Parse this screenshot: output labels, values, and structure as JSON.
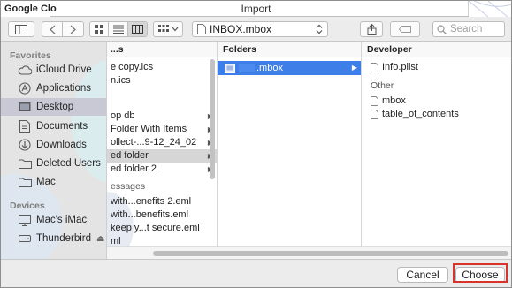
{
  "window": {
    "background_title": "Google Clo",
    "dialog_title": "Import"
  },
  "toolbar": {
    "path_label": "INBOX.mbox",
    "search_placeholder": "Search"
  },
  "sidebar": {
    "favorites_heading": "Favorites",
    "favorites": [
      {
        "label": "iCloud Drive",
        "icon": "cloud-icon"
      },
      {
        "label": "Applications",
        "icon": "applications-icon"
      },
      {
        "label": "Desktop",
        "icon": "desktop-icon",
        "selected": true
      },
      {
        "label": "Documents",
        "icon": "document-icon"
      },
      {
        "label": "Downloads",
        "icon": "download-icon"
      },
      {
        "label": "Deleted Users",
        "icon": "folder-icon"
      },
      {
        "label": "Mac",
        "icon": "folder-icon"
      }
    ],
    "devices_heading": "Devices",
    "devices": [
      {
        "label": "Mac's iMac",
        "icon": "computer-icon"
      },
      {
        "label": "Thunderbird",
        "icon": "drive-icon",
        "eject": "⏏"
      }
    ]
  },
  "column1": {
    "header": "...s",
    "rows": [
      {
        "label": "e copy.ics"
      },
      {
        "label": "n.ics"
      },
      {
        "label": ""
      },
      {
        "label": "op db",
        "arrow": true
      },
      {
        "label": "Folder With Items",
        "arrow": true
      },
      {
        "label": "ollect-...9-12_24_02",
        "arrow": true
      },
      {
        "label": "ed folder",
        "arrow": true,
        "selected": true
      },
      {
        "label": "ed folder 2",
        "arrow": true
      }
    ],
    "section2": "essages",
    "rows2": [
      {
        "label": "with...enefits 2.eml"
      },
      {
        "label": "with...benefits.eml"
      },
      {
        "label": "keep y...t secure.eml"
      },
      {
        "label": "ml"
      }
    ]
  },
  "column2": {
    "header": "Folders",
    "rows": [
      {
        "label": ".mbox",
        "selected": true,
        "arrow": true
      }
    ]
  },
  "column3": {
    "header": "Developer",
    "rows": [
      {
        "label": "Info.plist"
      }
    ],
    "section": "Other",
    "other_rows": [
      {
        "label": "mbox"
      },
      {
        "label": "table_of_contents"
      }
    ]
  },
  "buttons": {
    "cancel": "Cancel",
    "choose": "Choose"
  },
  "colors": {
    "selection_blue": "#3d7ee8",
    "highlight_red": "#d9342b"
  }
}
